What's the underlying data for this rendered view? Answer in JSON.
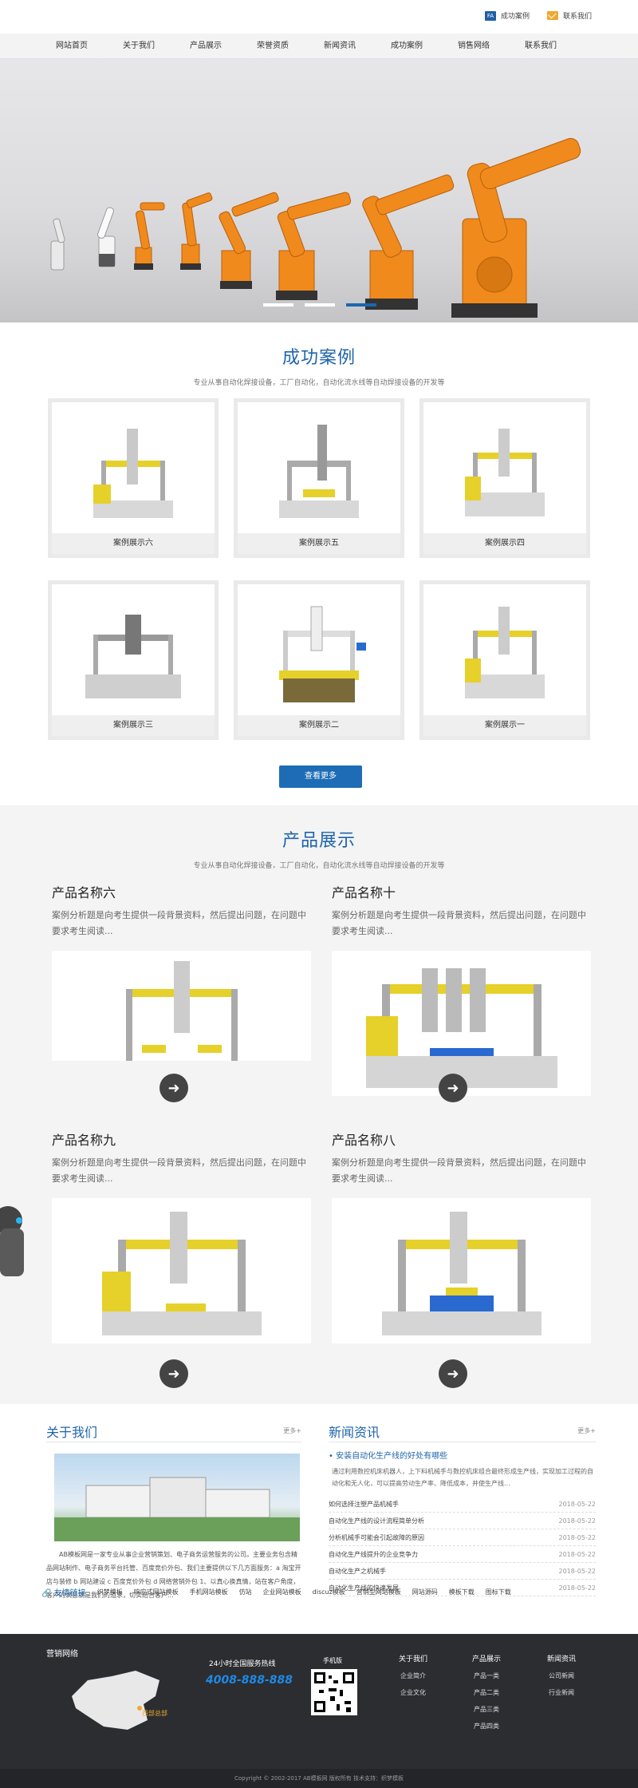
{
  "top": {
    "success_case": "成功案例",
    "contact": "联系我们",
    "fa_icon": "FA"
  },
  "nav": [
    "网站首页",
    "关于我们",
    "产品展示",
    "荣誉资质",
    "新闻资讯",
    "成功案例",
    "销售网络",
    "联系我们"
  ],
  "cases": {
    "title": "成功案例",
    "subtitle": "专业从事自动化焊接设备，工厂自动化，自动化流水线等自动焊接设备的开发等",
    "items": [
      "案例展示六",
      "案例展示五",
      "案例展示四",
      "案例展示三",
      "案例展示二",
      "案例展示一"
    ],
    "more": "查看更多"
  },
  "products": {
    "title": "产品展示",
    "subtitle": "专业从事自动化焊接设备，工厂自动化，自动化流水线等自动焊接设备的开发等",
    "items": [
      {
        "name": "产品名称六",
        "desc": "案例分析题是向考生提供一段背景资料，然后提出问题，在问题中要求考生阅读..."
      },
      {
        "name": "产品名称十",
        "desc": "案例分析题是向考生提供一段背景资料，然后提出问题，在问题中要求考生阅读..."
      },
      {
        "name": "产品名称九",
        "desc": "案例分析题是向考生提供一段背景资料，然后提出问题，在问题中要求考生阅读..."
      },
      {
        "name": "产品名称八",
        "desc": "案例分析题是向考生提供一段背景资料，然后提出问题，在问题中要求考生阅读..."
      }
    ]
  },
  "about": {
    "title": "关于我们",
    "more": "更多+",
    "text": "AB模板网是一家专业从事企业营销策划、电子商务运营服务的公司。主要业务包含精品网站制作、电子商务平台托管、百度竞价外包、我们主要提供以下几方面服务：a 淘宝开店与装修 b 网站建设 c 百度竞价外包 d 网络营销外包 1、以真心换真情，站在客户角度，客户的满意就是我们的追求，切实结合客户..."
  },
  "news": {
    "title": "新闻资讯",
    "more": "更多+",
    "headline": "安装自动化生产线的好处有哪些",
    "headline_desc": "通过利用数控机床机器人，上下料机械手与数控机床组合最终形成生产线，实现加工过程的自动化和无人化，可以提高劳动生产率、降低成本，并使生产线...",
    "items": [
      {
        "title": "如何选择注塑产品机械手",
        "date": "2018-05-22"
      },
      {
        "title": "自动化生产线的设计流程简单分析",
        "date": "2018-05-22"
      },
      {
        "title": "分析机械手可能会引起故障的原因",
        "date": "2018-05-22"
      },
      {
        "title": "自动化生产线提升的企业竞争力",
        "date": "2018-05-22"
      },
      {
        "title": "自动化生产之机械手",
        "date": "2018-05-22"
      },
      {
        "title": "自动化生产线的快速发展",
        "date": "2018-05-22"
      }
    ]
  },
  "links": {
    "title": "友情链接",
    "items": [
      "织梦模板",
      "响应式网站模板",
      "手机网站模板",
      "仿站",
      "企业网站模板",
      "discuz模板",
      "营销型网站模板",
      "网站源码",
      "模板下载",
      "图标下载"
    ]
  },
  "footer": {
    "network": "营销网络",
    "map_tag": "西部总部",
    "hotline_label": "24小时全国服务热线",
    "hotline": "4008-888-888",
    "mobile": "手机版",
    "cols": [
      {
        "title": "关于我们",
        "items": [
          "企业简介",
          "企业文化"
        ]
      },
      {
        "title": "产品展示",
        "items": [
          "产品一类",
          "产品二类",
          "产品三类",
          "产品四类"
        ]
      },
      {
        "title": "新闻资讯",
        "items": [
          "公司新闻",
          "行业新闻"
        ]
      }
    ],
    "copyright": "Copyright © 2002-2017 AB模板网 版权所有 技术支持：织梦模板"
  },
  "colors": {
    "brand": "#1f64aa",
    "robot": "#f08a1c",
    "footer": "#2b2d30"
  }
}
